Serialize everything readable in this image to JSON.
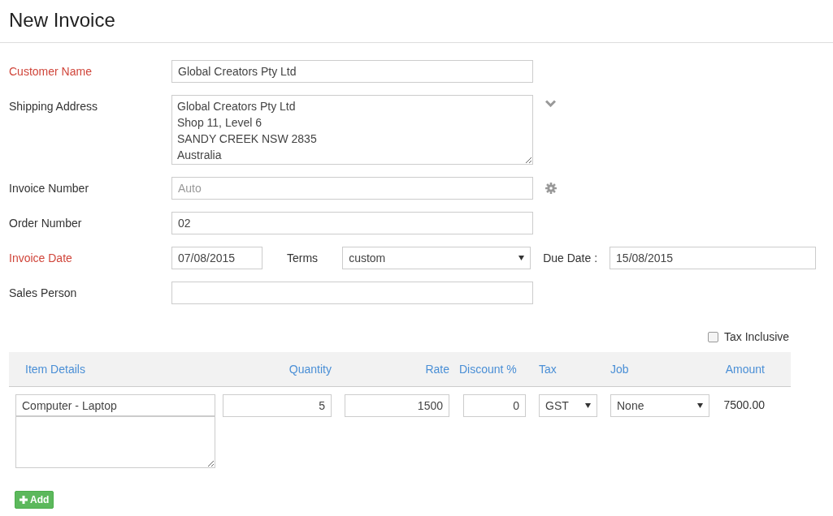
{
  "title": "New Invoice",
  "fields": [
    {
      "kind": "text",
      "label": "Customer Name",
      "required": true,
      "value": "Global Creators Pty Ltd"
    },
    {
      "kind": "textarea",
      "label": "Shipping Address",
      "required": false,
      "lines": [
        "Global Creators Pty Ltd",
        "Shop 11, Level 6",
        "SANDY CREEK NSW 2835",
        "Australia"
      ],
      "toggle": true
    },
    {
      "kind": "text",
      "label": "Invoice Number",
      "required": false,
      "placeholder": "Auto",
      "settings": true
    },
    {
      "kind": "text",
      "label": "Order Number",
      "required": false,
      "value": "02"
    },
    {
      "kind": "dates",
      "label": "Invoice Date",
      "required": true,
      "value": "07/08/2015",
      "terms_label": "Terms",
      "terms": "custom",
      "due_label": "Due Date :",
      "due_value": "15/08/2015"
    },
    {
      "kind": "text",
      "label": "Sales Person",
      "required": false
    }
  ],
  "tax_inclusive": {
    "label": "Tax Inclusive",
    "checked": false
  },
  "table": {
    "columns": [
      "Item Details",
      "Quantity",
      "Rate",
      "Discount %",
      "Tax",
      "Job",
      "Amount"
    ],
    "rows": [
      {
        "item": "Computer - Laptop",
        "quantity": "5",
        "rate": "1500",
        "discount": "0",
        "tax": "GST",
        "job": "None",
        "amount": "7500.00"
      }
    ]
  },
  "add_button": "Add"
}
